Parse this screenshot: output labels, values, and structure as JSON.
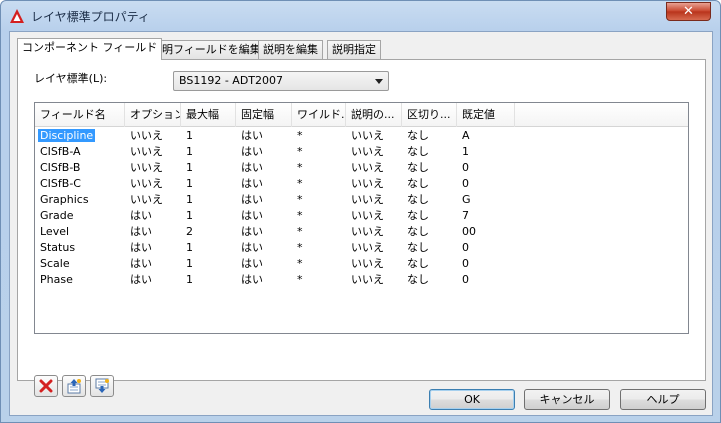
{
  "window": {
    "title": "レイヤ標準プロパティ",
    "close_label": "✕"
  },
  "tabs": [
    {
      "label": "コンポーネント フィールド",
      "active": true
    },
    {
      "label": "説明フィールドを編集",
      "active": false
    },
    {
      "label": "説明を編集",
      "active": false
    },
    {
      "label": "説明指定",
      "active": false
    }
  ],
  "layer_standard": {
    "label": "レイヤ標準(L):",
    "value": "BS1192 - ADT2007"
  },
  "table": {
    "columns": [
      "フィールド名",
      "オプション",
      "最大幅",
      "固定幅",
      "ワイルド...",
      "説明の...",
      "区切り...",
      "既定値"
    ],
    "rows": [
      [
        "Discipline",
        "いいえ",
        "1",
        "はい",
        "*",
        "いいえ",
        "なし",
        "A"
      ],
      [
        "CISfB-A",
        "いいえ",
        "1",
        "はい",
        "*",
        "いいえ",
        "なし",
        "1"
      ],
      [
        "CISfB-B",
        "いいえ",
        "1",
        "はい",
        "*",
        "いいえ",
        "なし",
        "0"
      ],
      [
        "CISfB-C",
        "いいえ",
        "1",
        "はい",
        "*",
        "いいえ",
        "なし",
        "0"
      ],
      [
        "Graphics",
        "いいえ",
        "1",
        "はい",
        "*",
        "いいえ",
        "なし",
        "G"
      ],
      [
        "Grade",
        "はい",
        "1",
        "はい",
        "*",
        "いいえ",
        "なし",
        "7"
      ],
      [
        "Level",
        "はい",
        "2",
        "はい",
        "*",
        "いいえ",
        "なし",
        "00"
      ],
      [
        "Status",
        "はい",
        "1",
        "はい",
        "*",
        "いいえ",
        "なし",
        "0"
      ],
      [
        "Scale",
        "はい",
        "1",
        "はい",
        "*",
        "いいえ",
        "なし",
        "0"
      ],
      [
        "Phase",
        "はい",
        "1",
        "はい",
        "*",
        "いいえ",
        "なし",
        "0"
      ]
    ],
    "selected_row": 0
  },
  "toolbar_icons": [
    "delete-icon",
    "move-up-icon",
    "move-down-icon"
  ],
  "buttons": {
    "ok": "OK",
    "cancel": "キャンセル",
    "help": "ヘルプ"
  },
  "colors": {
    "selection": "#3399ff",
    "delete_red": "#d42020",
    "accent_blue": "#3c7fb1"
  }
}
